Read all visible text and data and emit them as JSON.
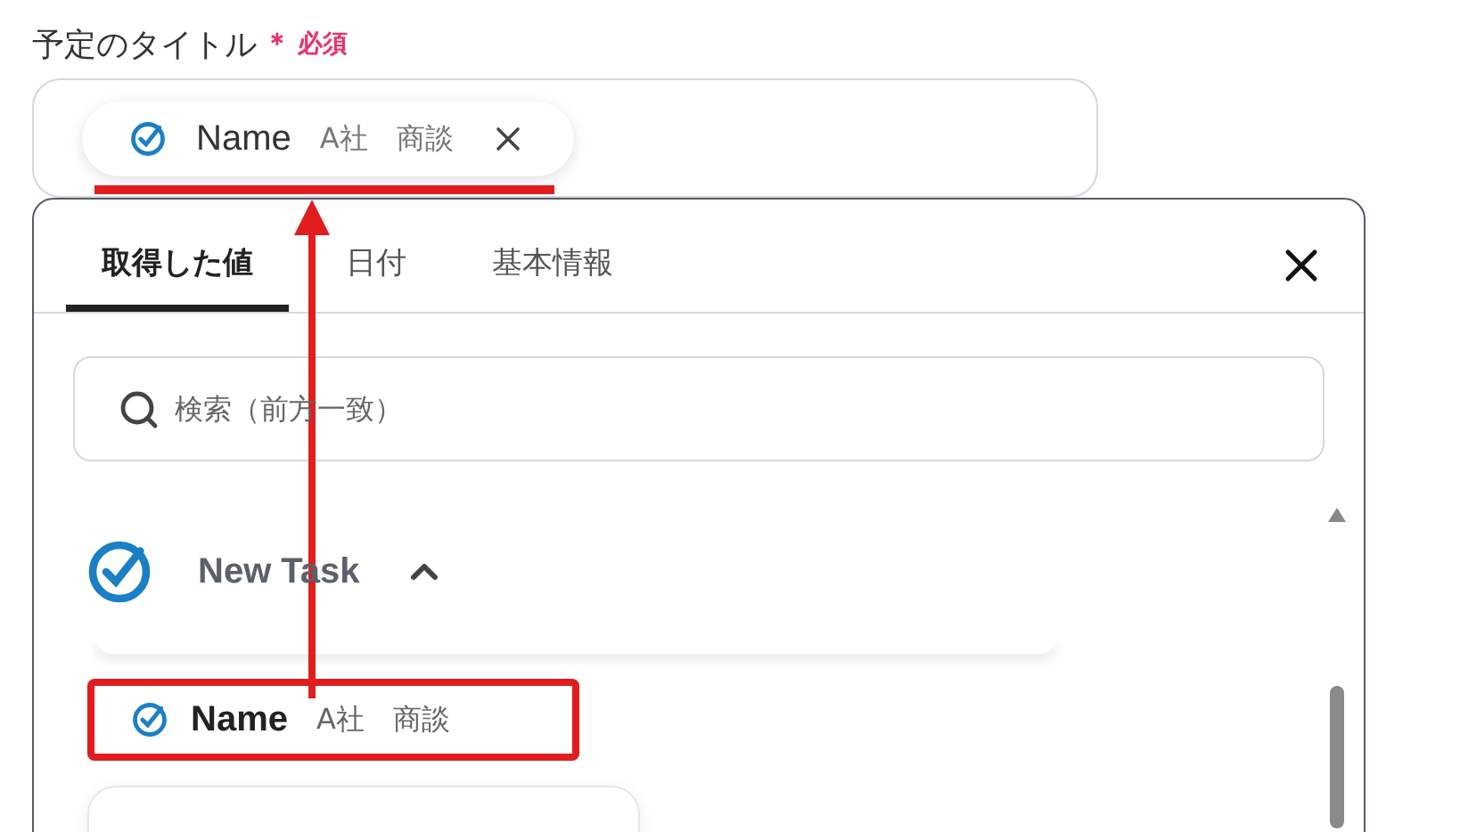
{
  "field": {
    "label": "予定のタイトル",
    "required_mark": "＊",
    "required_text": "必須",
    "chip": {
      "name": "Name",
      "meta": [
        "A社",
        "商談"
      ]
    }
  },
  "dropdown": {
    "tabs": [
      {
        "label": "取得した値",
        "selected": true
      },
      {
        "label": "日付",
        "selected": false
      },
      {
        "label": "基本情報",
        "selected": false
      }
    ],
    "search": {
      "placeholder": "検索（前方一致）"
    },
    "group": {
      "title": "New Task",
      "expanded": true,
      "items": [
        {
          "name": "Name",
          "meta": [
            "A社",
            "商談"
          ],
          "highlighted": true
        }
      ]
    }
  }
}
